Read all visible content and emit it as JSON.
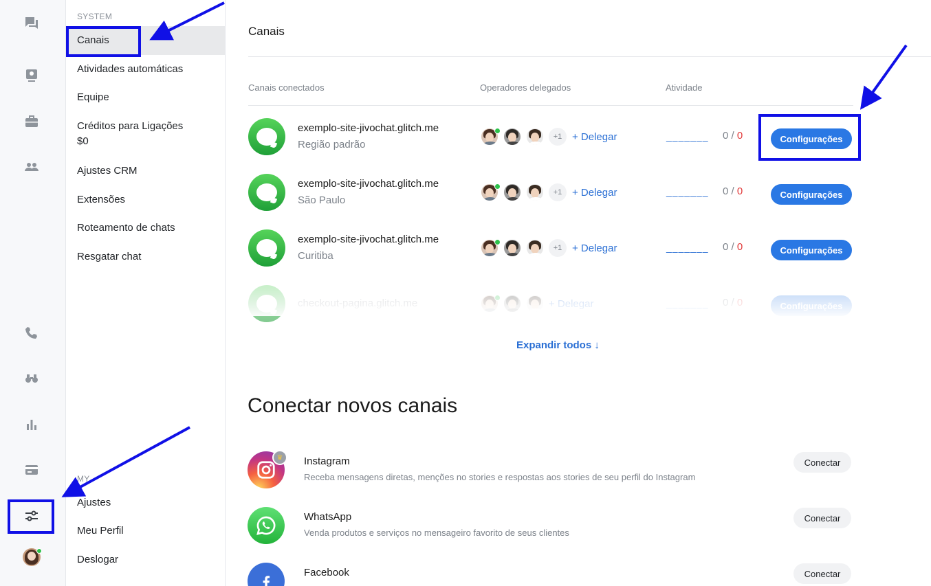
{
  "sidebar": {
    "system_label": "SYSTEM",
    "items": [
      {
        "label": "Canais",
        "active": true
      },
      {
        "label": "Atividades automáticas"
      },
      {
        "label": "Equipe"
      },
      {
        "label": "Créditos para Ligações",
        "sub": "$0"
      },
      {
        "label": "Ajustes CRM"
      },
      {
        "label": "Extensões"
      },
      {
        "label": "Roteamento de chats"
      },
      {
        "label": "Resgatar chat"
      }
    ],
    "my_label": "MY",
    "my_items": [
      {
        "label": "Ajustes"
      },
      {
        "label": "Meu Perfil"
      },
      {
        "label": "Deslogar"
      }
    ]
  },
  "rail": {
    "icons": [
      "chats-icon",
      "contacts-card-icon",
      "briefcase-icon",
      "team-icon",
      "phone-icon",
      "binoculars-icon",
      "stats-icon",
      "billing-card-icon",
      "settings-sliders-icon"
    ]
  },
  "main": {
    "title": "Canais",
    "columns": {
      "connected": "Canais conectados",
      "operators": "Operadores delegados",
      "activity": "Atividade"
    },
    "channels": [
      {
        "name": "exemplo-site-jivochat.glitch.me",
        "region": "Região padrão",
        "extra_ops": "+1",
        "delegate": "+ Delegar",
        "activity": "_______",
        "count": "0",
        "sep": "/",
        "total": "0",
        "button": "Configurações"
      },
      {
        "name": "exemplo-site-jivochat.glitch.me",
        "region": "São Paulo",
        "extra_ops": "+1",
        "delegate": "+ Delegar",
        "activity": "_______",
        "count": "0",
        "sep": "/",
        "total": "0",
        "button": "Configurações"
      },
      {
        "name": "exemplo-site-jivochat.glitch.me",
        "region": "Curitiba",
        "extra_ops": "+1",
        "delegate": "+ Delegar",
        "activity": "_______",
        "count": "0",
        "sep": "/",
        "total": "0",
        "button": "Configurações"
      },
      {
        "name": "checkout-pagina.glitch.me",
        "region": "",
        "extra_ops": "",
        "delegate": "+ Delegar",
        "activity": "_______",
        "count": "0",
        "sep": "/",
        "total": "0",
        "button": "Configurações"
      }
    ],
    "expand_label": "Expandir todos ↓",
    "connect_title": "Conectar novos canais",
    "new_channels": [
      {
        "name": "Instagram",
        "desc": "Receba mensagens diretas, menções no stories e respostas aos stories de seu perfil do Instagram",
        "button": "Conectar"
      },
      {
        "name": "WhatsApp",
        "desc": "Venda produtos e serviços no mensageiro favorito de seus clientes",
        "button": "Conectar"
      },
      {
        "name": "Facebook",
        "desc": "",
        "button": "Conectar"
      }
    ]
  },
  "colors": {
    "accent": "#2a78e4",
    "link": "#2a6fd4",
    "annotation": "#1010e6",
    "online": "#2ec24c",
    "danger": "#e23b3b"
  }
}
